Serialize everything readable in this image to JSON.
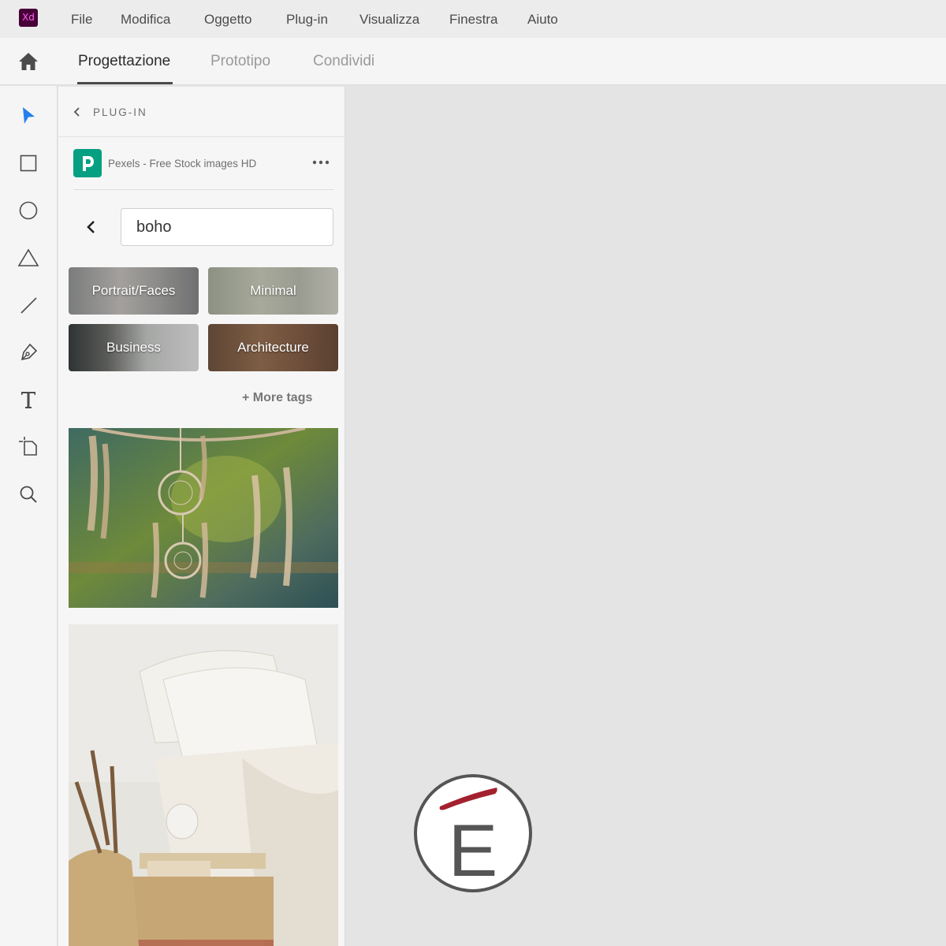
{
  "app": {
    "logo_text": "Xd",
    "menu": [
      "File",
      "Modifica",
      "Oggetto",
      "Plug-in",
      "Visualizza",
      "Finestra",
      "Aiuto"
    ]
  },
  "tabs": [
    {
      "label": "Progettazione",
      "active": true
    },
    {
      "label": "Prototipo",
      "active": false
    },
    {
      "label": "Condividi",
      "active": false
    }
  ],
  "toolbar": {
    "tools": [
      "select-icon",
      "rectangle-icon",
      "ellipse-icon",
      "polygon-icon",
      "line-icon",
      "pen-icon",
      "text-icon",
      "artboard-icon",
      "zoom-icon"
    ],
    "active_color": "#2680eb"
  },
  "panel": {
    "title": "PLUG-IN",
    "plugin_name": "Pexels - Free Stock images HD",
    "plugin_color": "#05a081",
    "search_value": "boho",
    "tags": [
      "Portrait/Faces",
      "Minimal",
      "Business",
      "Architecture"
    ],
    "more_tags": "+ More tags"
  },
  "badge": {
    "letter": "E",
    "accent_color": "#a3212e"
  }
}
